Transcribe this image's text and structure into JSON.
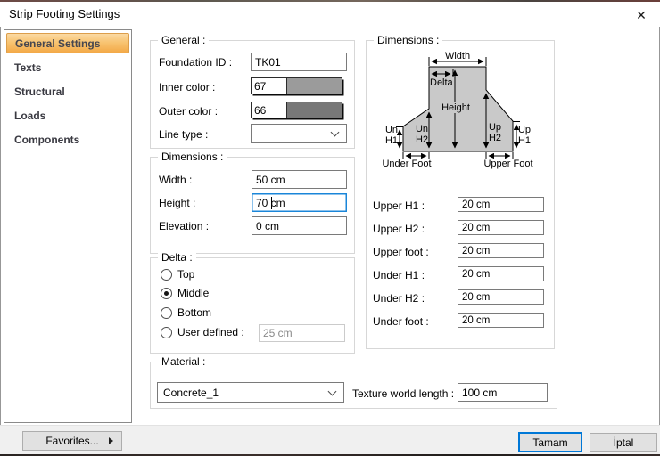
{
  "window": {
    "title": "Strip Footing Settings",
    "close_icon": "✕"
  },
  "sidebar": {
    "items": [
      {
        "label": "General Settings",
        "selected": true
      },
      {
        "label": "Texts",
        "selected": false
      },
      {
        "label": "Structural",
        "selected": false
      },
      {
        "label": "Loads",
        "selected": false
      },
      {
        "label": "Components",
        "selected": false
      }
    ]
  },
  "general": {
    "legend": "General :",
    "foundation_id": {
      "label": "Foundation ID :",
      "value": "TK01"
    },
    "inner_color": {
      "label": "Inner color :",
      "value": "67",
      "swatch": "#9b9b9b"
    },
    "outer_color": {
      "label": "Outer color :",
      "value": "66",
      "swatch": "#787878"
    },
    "line_type": {
      "label": "Line type :"
    }
  },
  "dimensions": {
    "legend": "Dimensions :",
    "width": {
      "label": "Width :",
      "value": "50 cm"
    },
    "height": {
      "label": "Height :",
      "value": "70 cm",
      "focused": true
    },
    "elevation": {
      "label": "Elevation :",
      "value": "0 cm"
    }
  },
  "delta": {
    "legend": "Delta :",
    "options": [
      {
        "label": "Top",
        "selected": false
      },
      {
        "label": "Middle",
        "selected": true
      },
      {
        "label": "Bottom",
        "selected": false
      },
      {
        "label": "User defined :",
        "selected": false
      }
    ],
    "user_defined_value": "25 cm"
  },
  "material": {
    "legend": "Material :",
    "selected_material": "Concrete_1",
    "texture_label": "Texture world length :",
    "texture_value": "100 cm"
  },
  "footing_dimensions": {
    "legend": "Dimensions :",
    "diagram": {
      "fill": "#c9c9c9",
      "width": "Width",
      "delta": "Delta",
      "height": "Height",
      "un_h1_line1": "Un",
      "un_h1_line2": "H1",
      "un_h2_line1": "Un",
      "un_h2_line2": "H2",
      "up_h2_line1": "Up",
      "up_h2_line2": "H2",
      "up_h1_line1": "Up",
      "up_h1_line2": "H1",
      "under_foot": "Under Foot",
      "upper_foot": "Upper Foot"
    },
    "fields": [
      {
        "label": "Upper H1 :",
        "value": "20 cm"
      },
      {
        "label": "Upper H2 :",
        "value": "20 cm"
      },
      {
        "label": "Upper foot :",
        "value": "20 cm"
      },
      {
        "label": "Under H1 :",
        "value": "20 cm"
      },
      {
        "label": "Under H2 :",
        "value": "20 cm"
      },
      {
        "label": "Under foot :",
        "value": "20 cm"
      }
    ]
  },
  "footer": {
    "favorites_label": "Favorites...",
    "ok_label": "Tamam",
    "cancel_label": "İptal"
  },
  "colors": {
    "focus_border": "#0078d7",
    "selection_orange_border": "#dc9e4b",
    "inner_swatch": "#9b9b9b",
    "outer_swatch": "#787878"
  }
}
